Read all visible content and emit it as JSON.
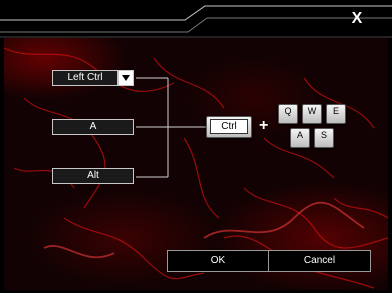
{
  "window": {
    "close_label": "X"
  },
  "modifier_inputs": [
    {
      "value": "Left Ctrl"
    },
    {
      "value": "A"
    },
    {
      "value": "Alt"
    }
  ],
  "combo": {
    "modifier_key_label": "Ctrl",
    "plus_label": "+",
    "keys_row1": [
      "Q",
      "W",
      "E"
    ],
    "keys_row2": [
      "A",
      "S"
    ]
  },
  "buttons": {
    "ok_label": "OK",
    "cancel_label": "Cancel"
  },
  "colors": {
    "accent": "#cc0000",
    "background": "#120203",
    "frame": "#b0b0b0"
  }
}
